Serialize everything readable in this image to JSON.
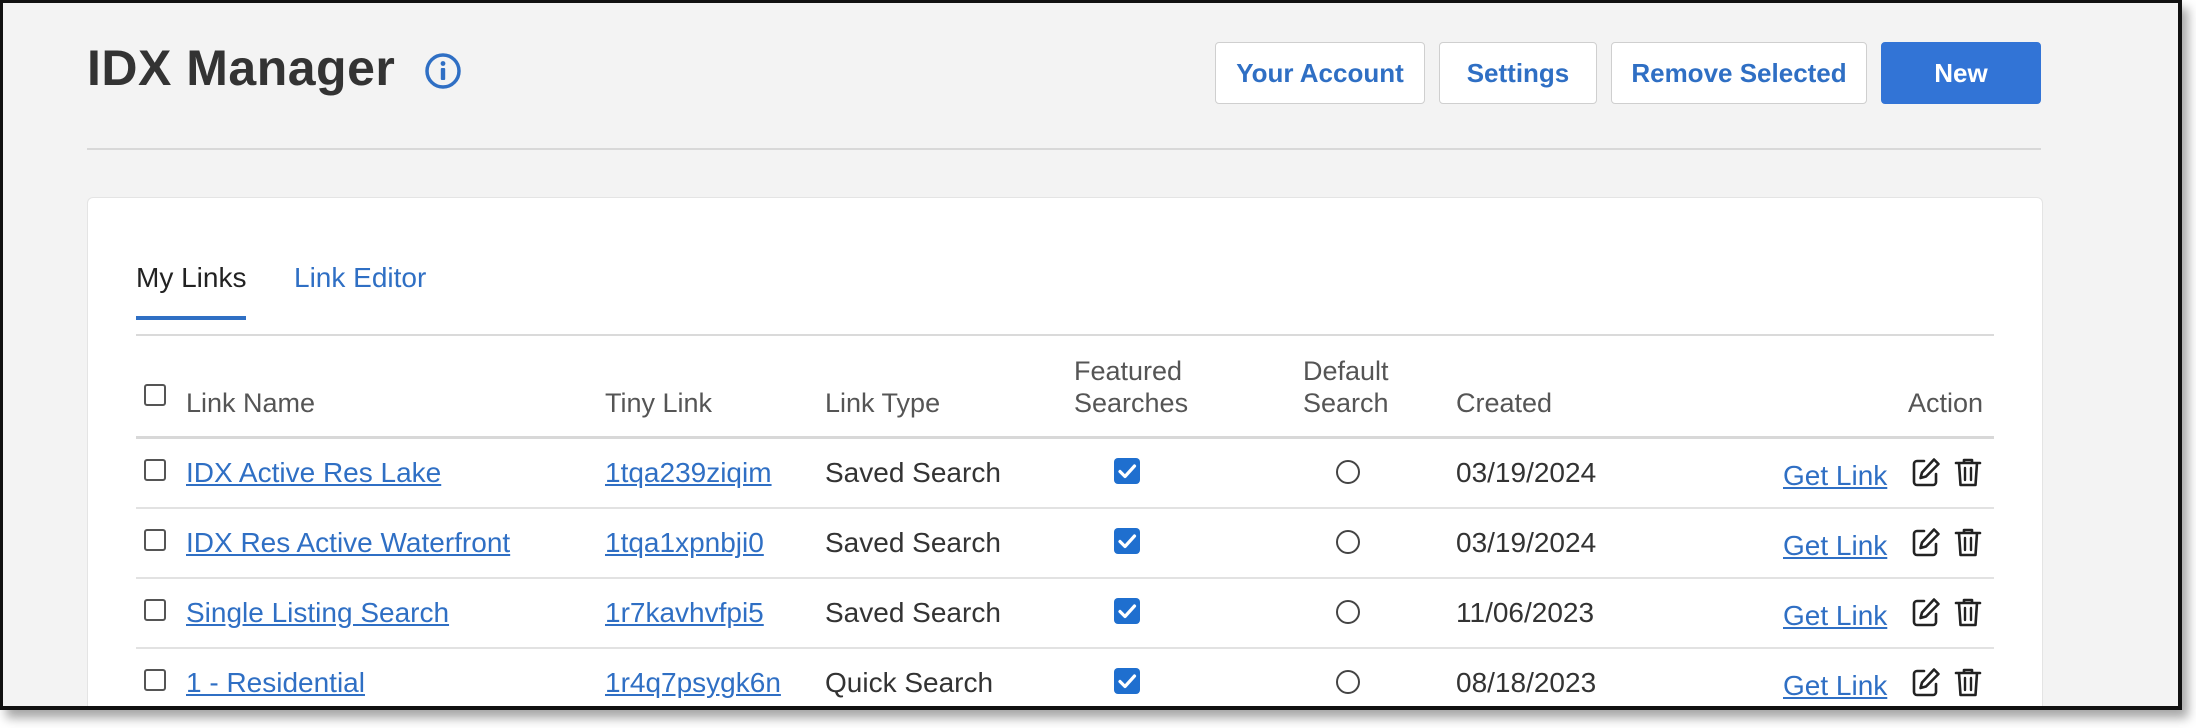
{
  "header": {
    "title": "IDX Manager",
    "info_icon": "info-icon",
    "buttons": {
      "your_account": "Your Account",
      "settings": "Settings",
      "remove_selected": "Remove Selected",
      "new": "New"
    }
  },
  "tabs": [
    {
      "label": "My Links",
      "active": true
    },
    {
      "label": "Link Editor",
      "active": false
    }
  ],
  "table": {
    "columns": {
      "link_name": "Link Name",
      "tiny_link": "Tiny Link",
      "link_type": "Link Type",
      "featured_line1": "Featured",
      "featured_line2": "Searches",
      "default_line1": "Default",
      "default_line2": "Search",
      "created": "Created",
      "action": "Action"
    },
    "rows": [
      {
        "name": "IDX Active Res Lake",
        "tiny": "1tqa239ziqim",
        "type": "Saved Search",
        "featured": true,
        "default": false,
        "created": "03/19/2024",
        "get_link": "Get Link"
      },
      {
        "name": "IDX Res Active Waterfront",
        "tiny": "1tqa1xpnbji0",
        "type": "Saved Search",
        "featured": true,
        "default": false,
        "created": "03/19/2024",
        "get_link": "Get Link"
      },
      {
        "name": "Single Listing Search",
        "tiny": "1r7kavhvfpi5",
        "type": "Saved Search",
        "featured": true,
        "default": false,
        "created": "11/06/2023",
        "get_link": "Get Link"
      },
      {
        "name": "1 - Residential",
        "tiny": "1r4q7psygk6n",
        "type": "Quick Search",
        "featured": true,
        "default": false,
        "created": "08/18/2023",
        "get_link": "Get Link"
      }
    ]
  },
  "colors": {
    "accent": "#3274d6",
    "link": "#2f6fc4",
    "checkbox_checked": "#1f6fcf",
    "background": "#f3f3f3"
  },
  "icons": {
    "edit": "edit-icon",
    "delete": "trash-icon"
  }
}
